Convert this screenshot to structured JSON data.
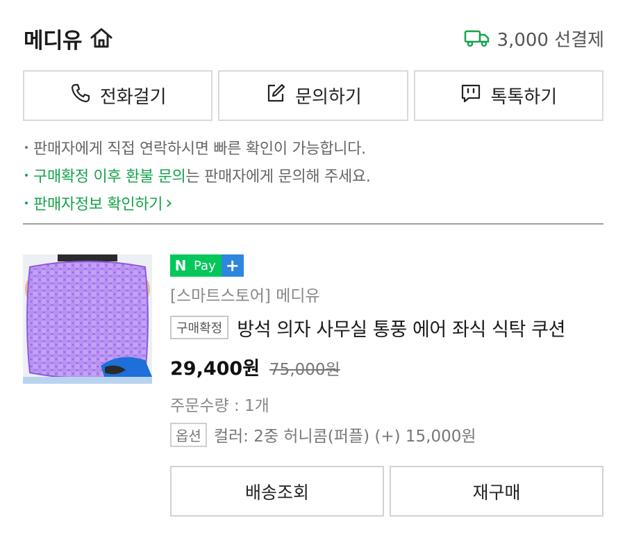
{
  "header": {
    "store_name": "메디유",
    "shipping_text": "3,000 선결제",
    "accent_color": "#16a34a"
  },
  "contact": {
    "call_label": "전화걸기",
    "inquiry_label": "문의하기",
    "talk_label": "톡톡하기"
  },
  "notices": {
    "line1": "판매자에게 직접 연락하시면 빠른 확인이 가능합니다.",
    "line2_highlight": "구매확정 이후 환불 문의",
    "line2_rest": "는 판매자에게 문의해 주세요.",
    "line3_link": "판매자정보 확인하기",
    "line3_arrow": "›"
  },
  "product": {
    "image_alt": "purple honeycomb gel seat cushion",
    "npay": {
      "n": "N",
      "pay": "Pay",
      "plus": "+"
    },
    "seller": "[스마트스토어] 메디유",
    "status_badge": "구매확정",
    "title": "방석 의자 사무실 통풍 에어 좌식 식탁 쿠션",
    "price": "29,400원",
    "original_price": "75,000원",
    "quantity": "주문수량 : 1개",
    "option_badge": "옵션",
    "option_text": "컬러: 2중 허니콤(퍼플) (+) 15,000원"
  },
  "actions": {
    "track_label": "배송조회",
    "rebuy_label": "재구매"
  }
}
